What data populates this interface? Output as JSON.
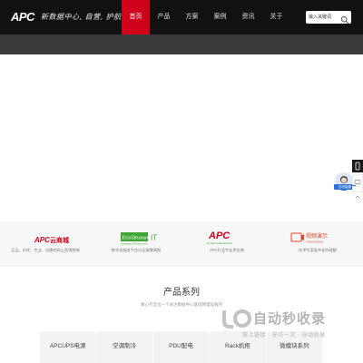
{
  "header": {
    "logo_text": "APC",
    "slogan": "新数据中心, 自营, 护航!",
    "nav": [
      "首页",
      "产品",
      "方案",
      "案例",
      "资讯",
      "关于"
    ],
    "active_index": 0,
    "search": {
      "placeholder": "输入关键词",
      "icon": "search-icon"
    }
  },
  "partners": [
    {
      "logo": "APC云商城",
      "caption": "正品、价优、专业、迅捷的网上直销商城"
    },
    {
      "logo": "EcoStruxure IT",
      "logo_sub": "Innovation At Every Level",
      "caption": "数字化服务平台以运维零周期"
    },
    {
      "logo": "APC",
      "logo_sub": "by Schneider Electric",
      "caption": "APC行业专业供应商"
    },
    {
      "logo": "视频演示",
      "logo_sub": "VIDEO DEMO",
      "caption": "技术专家复杂化的理解"
    }
  ],
  "side_float": {
    "label": "在线客服"
  },
  "products": {
    "title": "产品系列",
    "subtitle": "精心打造出一个关注数据中心基础管理设备的",
    "tabs": [
      "APCUPS电源",
      "空调制冷",
      "PDU配电",
      "Rack机柜",
      "微模块系列"
    ]
  },
  "watermark": {
    "text": "自动秒收录",
    "sub": "做上链接 · 来访一次 · 自动收录"
  },
  "colors": {
    "header_bg": "#111111",
    "accent": "#d0021b",
    "eco_green": "#3fa535"
  }
}
